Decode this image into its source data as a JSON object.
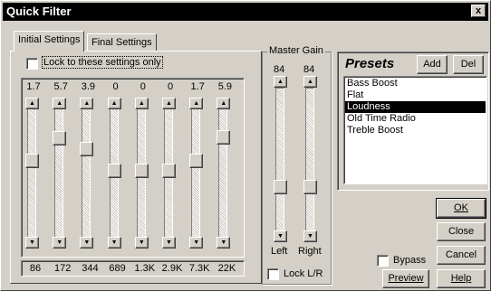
{
  "window": {
    "title": "Quick Filter",
    "close_glyph": "x"
  },
  "tabs": [
    {
      "label": "Initial Settings",
      "active": true
    },
    {
      "label": "Final Settings",
      "active": false
    }
  ],
  "lock_checkbox": {
    "label": "Lock to these settings only",
    "checked": false
  },
  "eq": {
    "values": [
      "1.7",
      "5.7",
      "3.9",
      "0",
      "0",
      "0",
      "1.7",
      "5.9"
    ],
    "levels": [
      1.7,
      5.7,
      3.9,
      0,
      0,
      0,
      1.7,
      5.9
    ],
    "frequencies": [
      "86",
      "172",
      "344",
      "689",
      "1.3K",
      "2.9K",
      "7.3K",
      "22K"
    ]
  },
  "master_gain": {
    "title": "Master Gain",
    "left_value": "84",
    "right_value": "84",
    "left_label": "Left",
    "right_label": "Right",
    "lock_label": "Lock L/R",
    "lock_checked": false
  },
  "presets": {
    "title": "Presets",
    "add_label": "Add",
    "del_label": "Del",
    "items": [
      "Bass Boost",
      "Flat",
      "Loudness",
      "Old Time Radio",
      "Treble Boost"
    ],
    "selected": "Loudness"
  },
  "buttons": {
    "ok": "OK",
    "close": "Close",
    "cancel": "Cancel",
    "help": "Help",
    "preview": "Preview",
    "bypass": "Bypass"
  },
  "colors": {
    "face": "#d4d0c8",
    "title_bg": "#000000",
    "selection": "#000000"
  }
}
